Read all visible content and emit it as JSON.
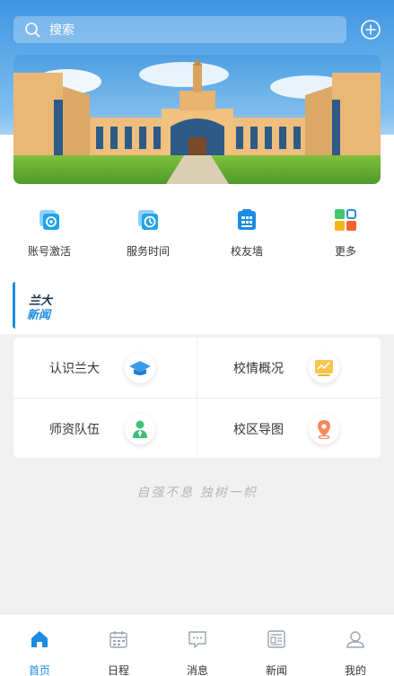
{
  "search": {
    "placeholder": "搜索"
  },
  "quick_links": [
    {
      "label": "账号激活",
      "icon": "account-activate-icon"
    },
    {
      "label": "服务时间",
      "icon": "service-time-icon"
    },
    {
      "label": "校友墙",
      "icon": "alumni-wall-icon"
    },
    {
      "label": "更多",
      "icon": "more-grid-icon"
    }
  ],
  "news_header": {
    "line1": "兰大",
    "line2": "新闻"
  },
  "grid": [
    {
      "label": "认识兰大",
      "icon": "graduation-cap-icon"
    },
    {
      "label": "校情概况",
      "icon": "chart-board-icon"
    },
    {
      "label": "师资队伍",
      "icon": "teacher-icon"
    },
    {
      "label": "校区导图",
      "icon": "map-pin-icon"
    }
  ],
  "slogan": "自强不息  独树一帜",
  "tabs": [
    {
      "label": "首页",
      "icon": "home-icon",
      "active": true
    },
    {
      "label": "日程",
      "icon": "calendar-icon",
      "active": false
    },
    {
      "label": "消息",
      "icon": "message-icon",
      "active": false
    },
    {
      "label": "新闻",
      "icon": "news-icon",
      "active": false
    },
    {
      "label": "我的",
      "icon": "profile-icon",
      "active": false
    }
  ],
  "colors": {
    "accent": "#1b8be3",
    "sky": "#4a9ee6"
  }
}
